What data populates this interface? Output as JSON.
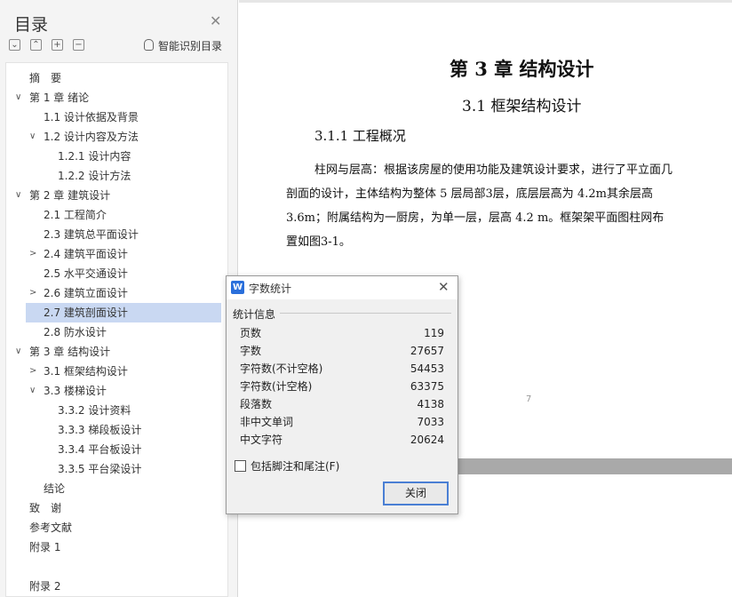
{
  "toc": {
    "title": "目录",
    "smart_label": "智能识别目录",
    "toolbar_icons": [
      "collapse-all-icon",
      "expand-all-icon",
      "add-level-icon",
      "remove-level-icon"
    ],
    "items": [
      {
        "label": "摘　要",
        "level": 0,
        "chevron": ""
      },
      {
        "label": "第 1 章  绪论",
        "level": 0,
        "chevron": "down"
      },
      {
        "label": "1.1 设计依据及背景",
        "level": 1,
        "chevron": ""
      },
      {
        "label": "1.2 设计内容及方法",
        "level": 1,
        "chevron": "down"
      },
      {
        "label": "1.2.1 设计内容",
        "level": 2,
        "chevron": ""
      },
      {
        "label": "1.2.2 设计方法",
        "level": 2,
        "chevron": ""
      },
      {
        "label": "第 2 章  建筑设计",
        "level": 0,
        "chevron": "down"
      },
      {
        "label": "2.1  工程简介",
        "level": 1,
        "chevron": ""
      },
      {
        "label": "2.3 建筑总平面设计",
        "level": 1,
        "chevron": ""
      },
      {
        "label": "2.4 建筑平面设计",
        "level": 1,
        "chevron": "right"
      },
      {
        "label": "2.5 水平交通设计",
        "level": 1,
        "chevron": ""
      },
      {
        "label": "2.6 建筑立面设计",
        "level": 1,
        "chevron": "right"
      },
      {
        "label": "2.7 建筑剖面设计",
        "level": 1,
        "chevron": "",
        "selected": true
      },
      {
        "label": "2.8 防水设计",
        "level": 1,
        "chevron": ""
      },
      {
        "label": "第 3 章  结构设计",
        "level": 0,
        "chevron": "down"
      },
      {
        "label": "3.1 框架结构设计",
        "level": 1,
        "chevron": "right"
      },
      {
        "label": "3.3  楼梯设计",
        "level": 1,
        "chevron": "down"
      },
      {
        "label": "3.3.2  设计资料",
        "level": 2,
        "chevron": ""
      },
      {
        "label": "3.3.3  梯段板设计",
        "level": 2,
        "chevron": ""
      },
      {
        "label": "3.3.4  平台板设计",
        "level": 2,
        "chevron": ""
      },
      {
        "label": "3.3.5  平台梁设计",
        "level": 2,
        "chevron": ""
      },
      {
        "label": "结论",
        "level": 1,
        "chevron": ""
      },
      {
        "label": "致　谢",
        "level": 0,
        "chevron": ""
      },
      {
        "label": "参考文献",
        "level": 0,
        "chevron": ""
      },
      {
        "label": "附录 1",
        "level": 0,
        "chevron": ""
      },
      {
        "label": "附录 2",
        "level": 0,
        "chevron": "",
        "gap": true
      }
    ]
  },
  "document": {
    "chapter_title": "第 3 章  结构设计",
    "section_title": "3.1 框架结构设计",
    "subsection_title": "3.1.1 工程概况",
    "paragraph_lines": [
      "柱网与层高：根据该房屋的使用功能及建筑设计要求，进行了平立面几",
      "剖面的设计，主体结构为整体  5  层局部3层，底层层高为  4.2m其余层高",
      "3.6m；附属结构为一厨房，为单一层，层高  4.2 m。框架架平面图柱网布",
      "置如图3-1。"
    ],
    "page_number": "7"
  },
  "dialog": {
    "title": "字数统计",
    "app_icon": "W",
    "section_heading": "统计信息",
    "stats": [
      {
        "label": "页数",
        "value": "119"
      },
      {
        "label": "字数",
        "value": "27657"
      },
      {
        "label": "字符数(不计空格)",
        "value": "54453"
      },
      {
        "label": "字符数(计空格)",
        "value": "63375"
      },
      {
        "label": "段落数",
        "value": "4138"
      },
      {
        "label": "非中文单词",
        "value": "7033"
      },
      {
        "label": "中文字符",
        "value": "20624"
      }
    ],
    "footnote_checkbox_label": "包括脚注和尾注(F)",
    "footnote_checked": false,
    "close_button_label": "关闭"
  },
  "colors": {
    "selection": "#c9d8f2",
    "accent": "#4a7fd4",
    "panel_bg": "#f4f4f4",
    "page_gap": "#a9a9a9"
  }
}
